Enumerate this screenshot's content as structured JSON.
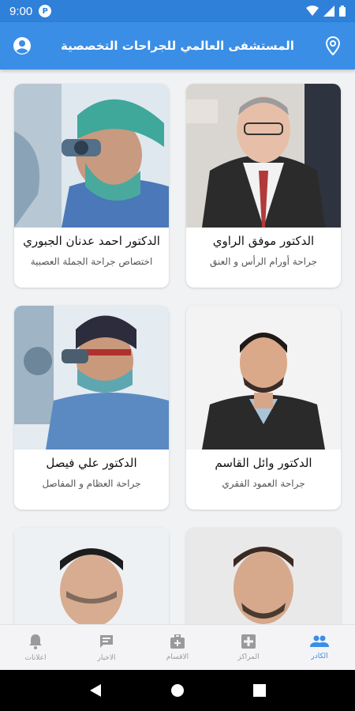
{
  "status_bar": {
    "time": "9:00",
    "notification_badge": "P"
  },
  "app_bar": {
    "title": "المستشفى العالمي للجراحات التخصصية"
  },
  "doctors": [
    {
      "name": "الدكتور موفق الراوي",
      "specialty": "جراحة أورام الرأس و العنق"
    },
    {
      "name": "الدكتور احمد عدنان الجبوري",
      "specialty": "اختصاص جراحة الجملة العصبية"
    },
    {
      "name": "الدكتور وائل القاسم",
      "specialty": "جراحة العمود الفقري"
    },
    {
      "name": "الدكتور علي فيصل",
      "specialty": "جراحة العظام و المفاصل"
    },
    {
      "name": "",
      "specialty": ""
    },
    {
      "name": "",
      "specialty": ""
    }
  ],
  "bottom_nav": {
    "items": [
      {
        "label": "اعلانات",
        "icon": "bell-icon"
      },
      {
        "label": "الاخبار",
        "icon": "chat-icon"
      },
      {
        "label": "الاقسام",
        "icon": "medical-bag-icon"
      },
      {
        "label": "المراكز",
        "icon": "hospital-plus-icon"
      },
      {
        "label": "الكادر",
        "icon": "people-icon"
      }
    ],
    "active": "الكادر",
    "accent": "#3a8ee6"
  },
  "colors": {
    "app_bar": "#3a8ee6",
    "status_bar": "#2f80d8"
  }
}
